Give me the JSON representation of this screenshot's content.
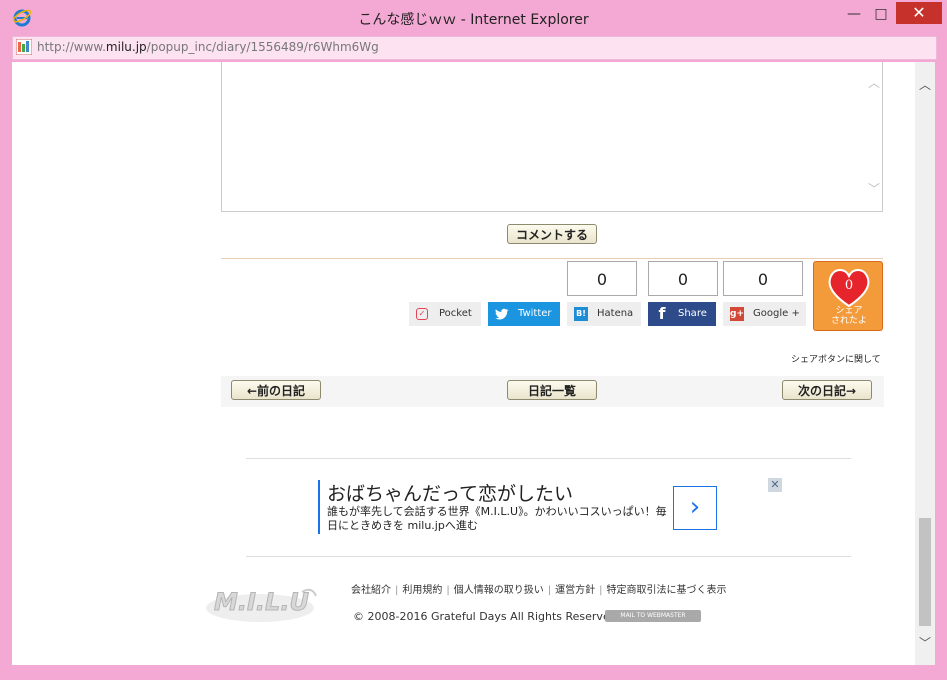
{
  "window": {
    "title": "こんな感じｗｗ - Internet Explorer",
    "min_glyph": "—",
    "max_glyph": "□",
    "close_glyph": "✕"
  },
  "address": {
    "prefix": "http://www.",
    "domain": "milu.jp",
    "path": "/popup_inc/diary/1556489/r6Whm6Wg"
  },
  "comment": {
    "submit_label": "コメントする"
  },
  "share": {
    "hatena_count": "0",
    "facebook_count": "0",
    "google_count": "0",
    "pocket_label": "Pocket",
    "twitter_label": "Twitter",
    "hatena_label": "Hatena",
    "facebook_label": "Share",
    "google_label": "Google +",
    "hatena_icon_text": "B!",
    "google_icon_text": "g+",
    "badge_count": "0",
    "badge_text_1": "シェア",
    "badge_text_2": "されたよ",
    "about_label": "シェアボタンに関して"
  },
  "nav": {
    "prev_label": "←前の日記",
    "list_label": "日記一覧",
    "next_label": "次の日記→"
  },
  "ad": {
    "title": "おばちゃんだって恋がしたい",
    "description": "誰もが率先して会話する世界《M.I.L.U》。かわいいコスいっぱい！毎日にときめきを milu.jpへ進む",
    "arrow": "›",
    "close": "✕"
  },
  "footer": {
    "logo_text": "M.I.L.U",
    "links": [
      "会社紹介",
      "利用規約",
      "個人情報の取り扱い",
      "運営方針",
      "特定商取引法に基づく表示"
    ],
    "copyright": "© 2008-2016 Grateful Days All Rights Reserved.",
    "mail_button": "MAIL TO WEBMASTER"
  },
  "colors": {
    "frame": "#f3a9d3",
    "twitter": "#1b95e0",
    "facebook": "#2d4a8a",
    "share_badge": "#f39a3a",
    "close_button": "#c7312b"
  }
}
